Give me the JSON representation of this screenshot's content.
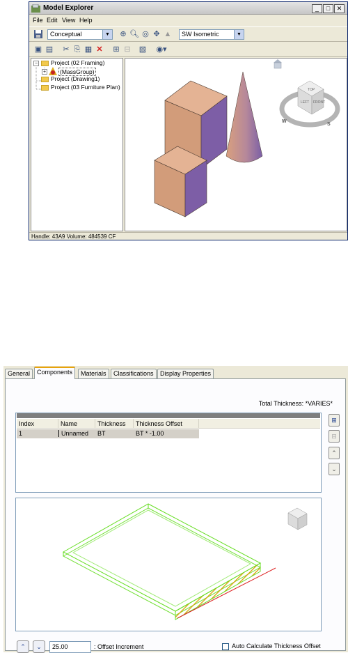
{
  "explorer": {
    "title": "Model Explorer",
    "menus": [
      "File",
      "Edit",
      "View",
      "Help"
    ],
    "display_style": "Conceptual",
    "view_direction": "SW Isometric",
    "tree": {
      "items": [
        {
          "label": "Project (02 Framing)",
          "expanded": true
        },
        {
          "label": "(MassGroup)",
          "selected": true
        },
        {
          "label": "Project (Drawing1)"
        },
        {
          "label": "Project (03 Furniture Plan)"
        }
      ]
    },
    "viewcube": {
      "top": "TOP",
      "left": "LEFT",
      "front": "FRONT",
      "w": "W",
      "s": "S"
    },
    "status": "Handle: 43A9  Volume: 484539 CF",
    "colors": {
      "box_left": "#d29c7a",
      "box_right": "#7d5ea6",
      "box_top": "#e4b394"
    }
  },
  "dialog": {
    "tabs": [
      "General",
      "Components",
      "Materials",
      "Classifications",
      "Display Properties"
    ],
    "active_tab": "Components",
    "total_thickness": "Total Thickness: *VARIES*",
    "columns": [
      "Index",
      "Name",
      "Thickness",
      "Thickness Offset"
    ],
    "rows": [
      {
        "index": "1",
        "name": "Unnamed",
        "thickness": "BT",
        "offset": "BT * -1.00"
      }
    ],
    "offset_increment_value": "25.00",
    "offset_increment_label": ": Offset Increment",
    "auto_calc_label": "Auto Calculate Thickness Offset",
    "auto_calc_checked": false
  }
}
